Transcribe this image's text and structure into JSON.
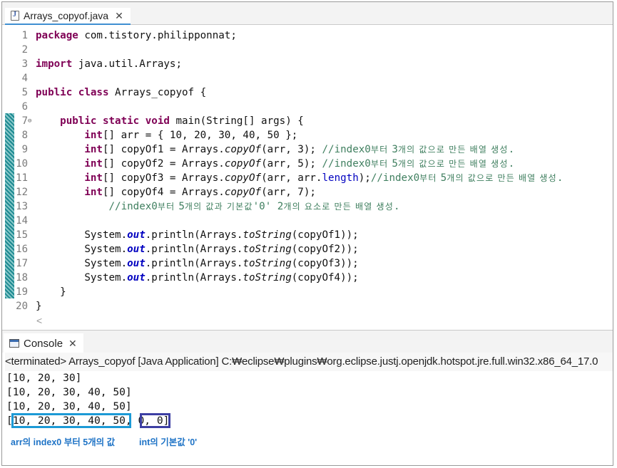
{
  "editor_tab": {
    "title": "Arrays_copyof.java",
    "close": "✕",
    "icon": "java-file-icon"
  },
  "code": [
    {
      "n": "1",
      "tokens": [
        {
          "t": "package",
          "c": "kw"
        },
        {
          "t": " com.tistory.philipponnat;"
        }
      ]
    },
    {
      "n": "2",
      "tokens": []
    },
    {
      "n": "3",
      "tokens": [
        {
          "t": "import",
          "c": "kw"
        },
        {
          "t": " java.util.Arrays;"
        }
      ]
    },
    {
      "n": "4",
      "tokens": []
    },
    {
      "n": "5",
      "tokens": [
        {
          "t": "public",
          "c": "kw"
        },
        {
          "t": " "
        },
        {
          "t": "class",
          "c": "kw"
        },
        {
          "t": " Arrays_copyof {"
        }
      ]
    },
    {
      "n": "6",
      "tokens": []
    },
    {
      "n": "7",
      "fold": "⊖",
      "tokens": [
        {
          "t": "    "
        },
        {
          "t": "public",
          "c": "kw"
        },
        {
          "t": " "
        },
        {
          "t": "static",
          "c": "kw"
        },
        {
          "t": " "
        },
        {
          "t": "void",
          "c": "kw"
        },
        {
          "t": " main(String[] args) {"
        }
      ]
    },
    {
      "n": "8",
      "tokens": [
        {
          "t": "        "
        },
        {
          "t": "int",
          "c": "kw"
        },
        {
          "t": "[] arr = { 10, 20, 30, 40, 50 };"
        }
      ]
    },
    {
      "n": "9",
      "tokens": [
        {
          "t": "        "
        },
        {
          "t": "int",
          "c": "kw"
        },
        {
          "t": "[] copyOf1 = Arrays."
        },
        {
          "t": "copyOf",
          "c": "st"
        },
        {
          "t": "(arr, 3); "
        },
        {
          "t": "//index0부터 3개의 값으로 만든 배열 생성.",
          "c": "cm"
        }
      ]
    },
    {
      "n": "10",
      "tokens": [
        {
          "t": "        "
        },
        {
          "t": "int",
          "c": "kw"
        },
        {
          "t": "[] copyOf2 = Arrays."
        },
        {
          "t": "copyOf",
          "c": "st"
        },
        {
          "t": "(arr, 5); "
        },
        {
          "t": "//index0부터 5개의 값으로 만든 배열 생성.",
          "c": "cm"
        }
      ]
    },
    {
      "n": "11",
      "tokens": [
        {
          "t": "        "
        },
        {
          "t": "int",
          "c": "kw"
        },
        {
          "t": "[] copyOf3 = Arrays."
        },
        {
          "t": "copyOf",
          "c": "st"
        },
        {
          "t": "(arr, arr."
        },
        {
          "t": "length",
          "c": "fld2"
        },
        {
          "t": ");"
        },
        {
          "t": "//index0부터 5개의 값으로 만든 배열 생성.",
          "c": "cm"
        }
      ]
    },
    {
      "n": "12",
      "tokens": [
        {
          "t": "        "
        },
        {
          "t": "int",
          "c": "kw"
        },
        {
          "t": "[] copyOf4 = Arrays."
        },
        {
          "t": "copyOf",
          "c": "st"
        },
        {
          "t": "(arr, 7);"
        }
      ]
    },
    {
      "n": "13",
      "tokens": [
        {
          "t": "            "
        },
        {
          "t": "//index0부터 5개의 값과 기본값'0' 2개의 요소로 만든 배열 생성.",
          "c": "cm"
        }
      ]
    },
    {
      "n": "14",
      "tokens": []
    },
    {
      "n": "15",
      "tokens": [
        {
          "t": "        System."
        },
        {
          "t": "out",
          "c": "fld"
        },
        {
          "t": ".println(Arrays."
        },
        {
          "t": "toString",
          "c": "st"
        },
        {
          "t": "(copyOf1));"
        }
      ]
    },
    {
      "n": "16",
      "tokens": [
        {
          "t": "        System."
        },
        {
          "t": "out",
          "c": "fld"
        },
        {
          "t": ".println(Arrays."
        },
        {
          "t": "toString",
          "c": "st"
        },
        {
          "t": "(copyOf2));"
        }
      ]
    },
    {
      "n": "17",
      "tokens": [
        {
          "t": "        System."
        },
        {
          "t": "out",
          "c": "fld"
        },
        {
          "t": ".println(Arrays."
        },
        {
          "t": "toString",
          "c": "st"
        },
        {
          "t": "(copyOf3));"
        }
      ]
    },
    {
      "n": "18",
      "tokens": [
        {
          "t": "        System."
        },
        {
          "t": "out",
          "c": "fld"
        },
        {
          "t": ".println(Arrays."
        },
        {
          "t": "toString",
          "c": "st"
        },
        {
          "t": "(copyOf4));"
        }
      ]
    },
    {
      "n": "19",
      "tokens": [
        {
          "t": "    }"
        }
      ]
    },
    {
      "n": "20",
      "tokens": [
        {
          "t": "}"
        }
      ]
    }
  ],
  "scroll_left": "<",
  "console_tab": {
    "title": "Console",
    "close": "✕",
    "icon": "console-icon"
  },
  "status_text": "<terminated> Arrays_copyof [Java Application] C:₩eclipse₩plugins₩org.eclipse.justj.openjdk.hotspot.jre.full.win32.x86_64_17.0",
  "output": [
    "[10, 20, 30]",
    "[10, 20, 30, 40, 50]",
    "[10, 20, 30, 40, 50]",
    "[10, 20, 30, 40, 50, 0, 0]"
  ],
  "annotations": {
    "left": "arr의 index0 부터 5개의 값",
    "right": "int의 기본값 '0'"
  },
  "colors": {
    "keyword": "#7f0055",
    "comment": "#3f7f5f",
    "field": "#0000c0",
    "highlight_box_1": "#1c9ad6",
    "highlight_box_2": "#3d3fa3",
    "annotation": "#1e73c6"
  }
}
